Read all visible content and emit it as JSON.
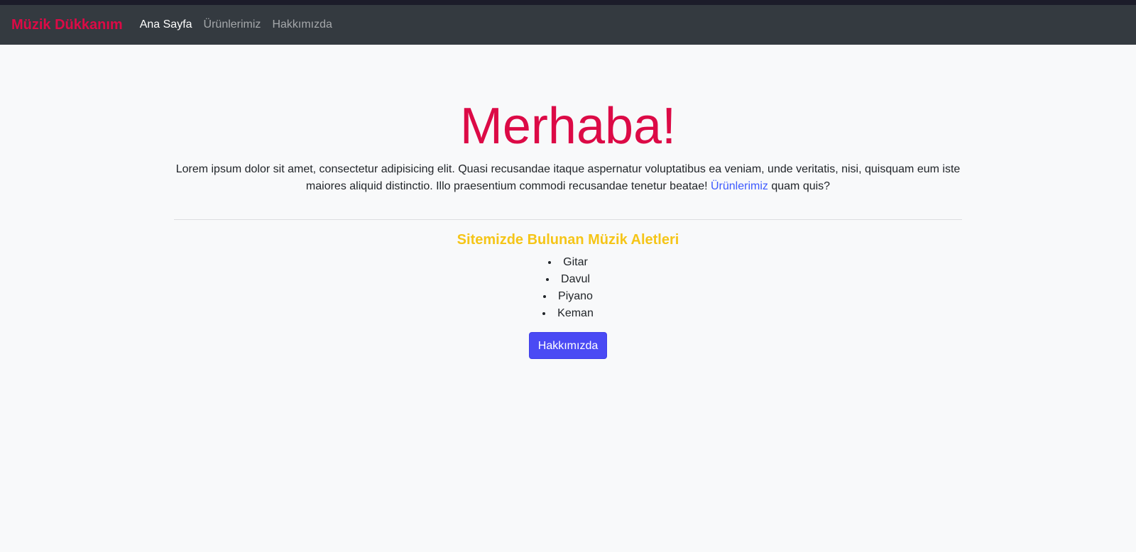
{
  "navbar": {
    "brand": "Müzik Dükkanım",
    "links": [
      {
        "label": "Ana Sayfa",
        "active": true
      },
      {
        "label": "Ürünlerimiz",
        "active": false
      },
      {
        "label": "Hakkımızda",
        "active": false
      }
    ]
  },
  "hero": {
    "title": "Merhaba!",
    "lead_before_link": "Lorem ipsum dolor sit amet, consectetur adipisicing elit. Quasi recusandae itaque aspernatur voluptatibus ea veniam, unde veritatis, nisi, quisquam eum iste maiores aliquid distinctio. Illo praesentium commodi recusandae tenetur beatae! ",
    "lead_link": "Ürünlerimiz",
    "lead_after_link": " quam quis?"
  },
  "instruments": {
    "title": "Sitemizde Bulunan Müzik Aletleri",
    "items": [
      "Gitar",
      "Davul",
      "Piyano",
      "Keman"
    ]
  },
  "about_button_label": "Hakkımızda",
  "colors": {
    "brand": "#dc0a46",
    "navbar_bg": "#343a40",
    "page_bg": "#f8f9fa",
    "section_title": "#f5c518",
    "link": "#3d5afe",
    "button": "#4a4af4"
  }
}
